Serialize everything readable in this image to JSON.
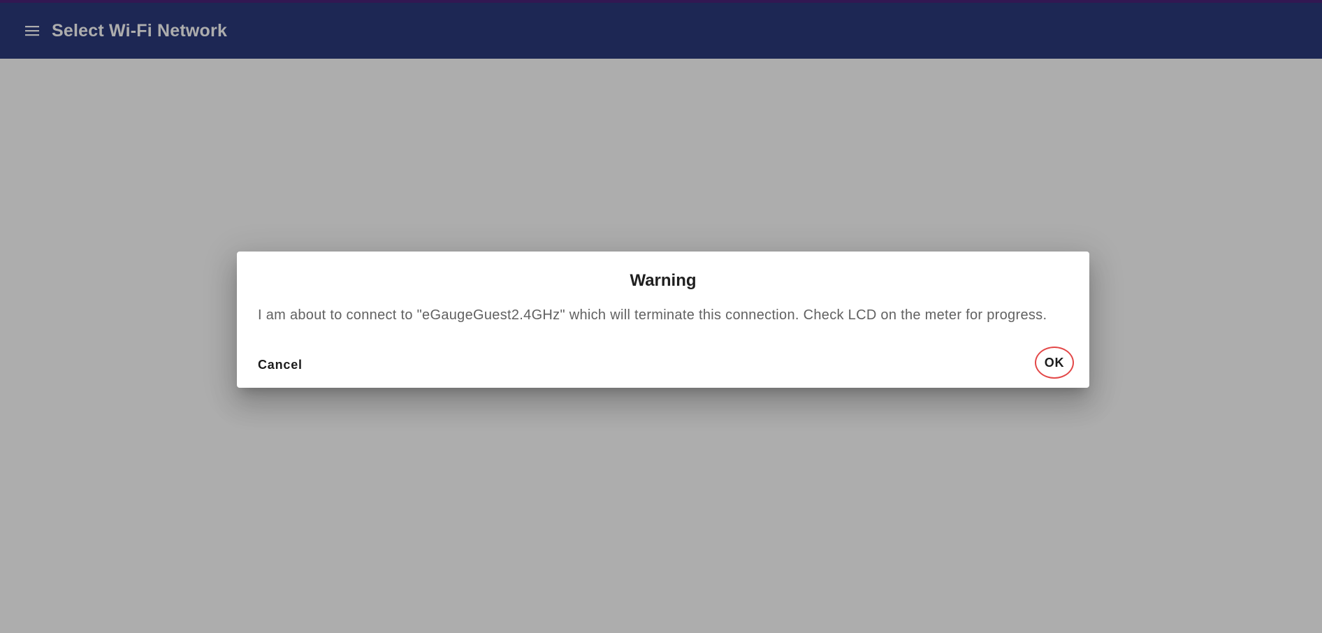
{
  "app_bar": {
    "title": "Select Wi-Fi Network",
    "menu_icon": "menu-icon",
    "color": "#2c3a7c"
  },
  "dialog": {
    "title": "Warning",
    "message": "I am about to connect to \"eGaugeGuest2.4GHz\" which will terminate this connection. Check LCD on the meter for progress.",
    "cancel_label": "Cancel",
    "ok_label": "OK",
    "highlight_color": "#e34848"
  }
}
